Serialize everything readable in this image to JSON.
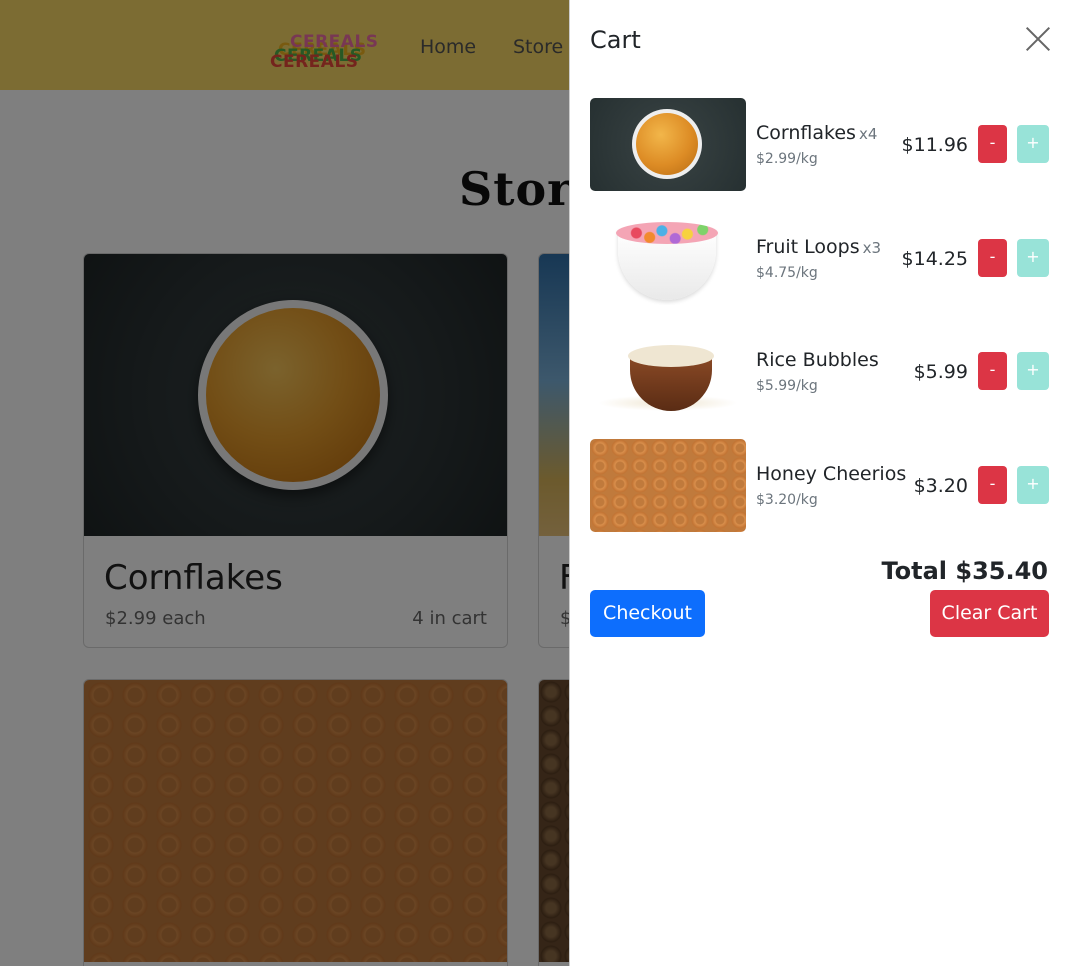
{
  "navbar": {
    "logo_text": "CEREALS",
    "links": [
      "Home",
      "Store"
    ]
  },
  "page": {
    "title": "Store",
    "cards": [
      {
        "name": "Cornflakes",
        "price": "$2.99 each",
        "in_cart": "4 in cart"
      },
      {
        "name": "F",
        "price": "$"
      }
    ]
  },
  "cart": {
    "title": "Cart",
    "items": [
      {
        "name": "Cornflakes",
        "qty": "x4",
        "unit_price": "$2.99/kg",
        "total": "$11.96"
      },
      {
        "name": "Fruit Loops",
        "qty": "x3",
        "unit_price": "$4.75/kg",
        "total": "$14.25"
      },
      {
        "name": "Rice Bubbles",
        "qty": "",
        "unit_price": "$5.99/kg",
        "total": "$5.99"
      },
      {
        "name": "Honey Cheerios",
        "qty": "",
        "unit_price": "$3.20/kg",
        "total": "$3.20"
      }
    ],
    "minus_label": "-",
    "plus_label": "+",
    "total_label": "Total $35.40",
    "checkout_label": "Checkout",
    "clear_label": "Clear Cart"
  },
  "colors": {
    "navbar": "#f8d866",
    "primary": "#0d6efd",
    "danger": "#dc3545",
    "plus_button": "#98e3d8"
  },
  "icons": [
    "close-icon"
  ]
}
